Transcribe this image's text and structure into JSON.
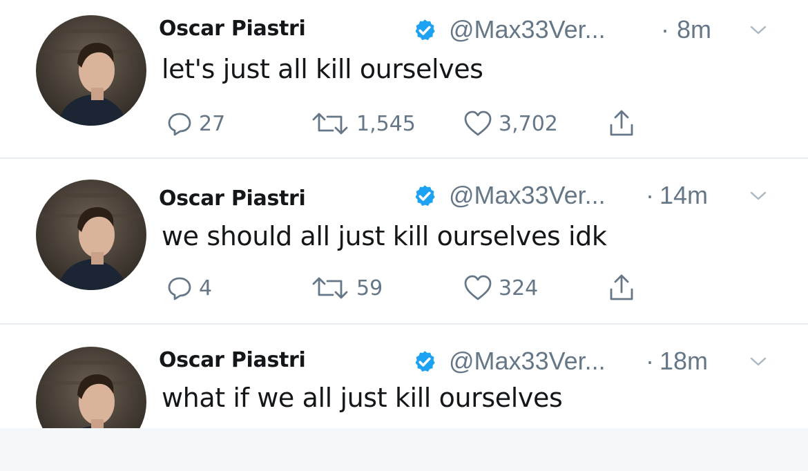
{
  "icons": {
    "verified": "verified-badge-icon",
    "caret": "chevron-down-icon",
    "reply": "reply-icon",
    "retweet": "retweet-icon",
    "like": "heart-icon",
    "share": "share-icon"
  },
  "colors": {
    "verified_blue": "#1da1f2",
    "secondary_text": "#657786",
    "primary_text": "#14171a",
    "divider": "#e6ecf0"
  },
  "tweets": [
    {
      "display_name": "Oscar Piastri",
      "handle": "@Max33Ver...",
      "dot": "·",
      "time": "8m",
      "text": "let's just all kill ourselves",
      "replies": "27",
      "retweets": "1,545",
      "likes": "3,702"
    },
    {
      "display_name": "Oscar Piastri",
      "handle": "@Max33Ver...",
      "dot": "·",
      "time": "14m",
      "text": "we should all just kill ourselves idk",
      "replies": "4",
      "retweets": "59",
      "likes": "324"
    },
    {
      "display_name": "Oscar Piastri",
      "handle": "@Max33Ver...",
      "dot": "·",
      "time": "18m",
      "text": "what if we all just kill ourselves"
    }
  ]
}
